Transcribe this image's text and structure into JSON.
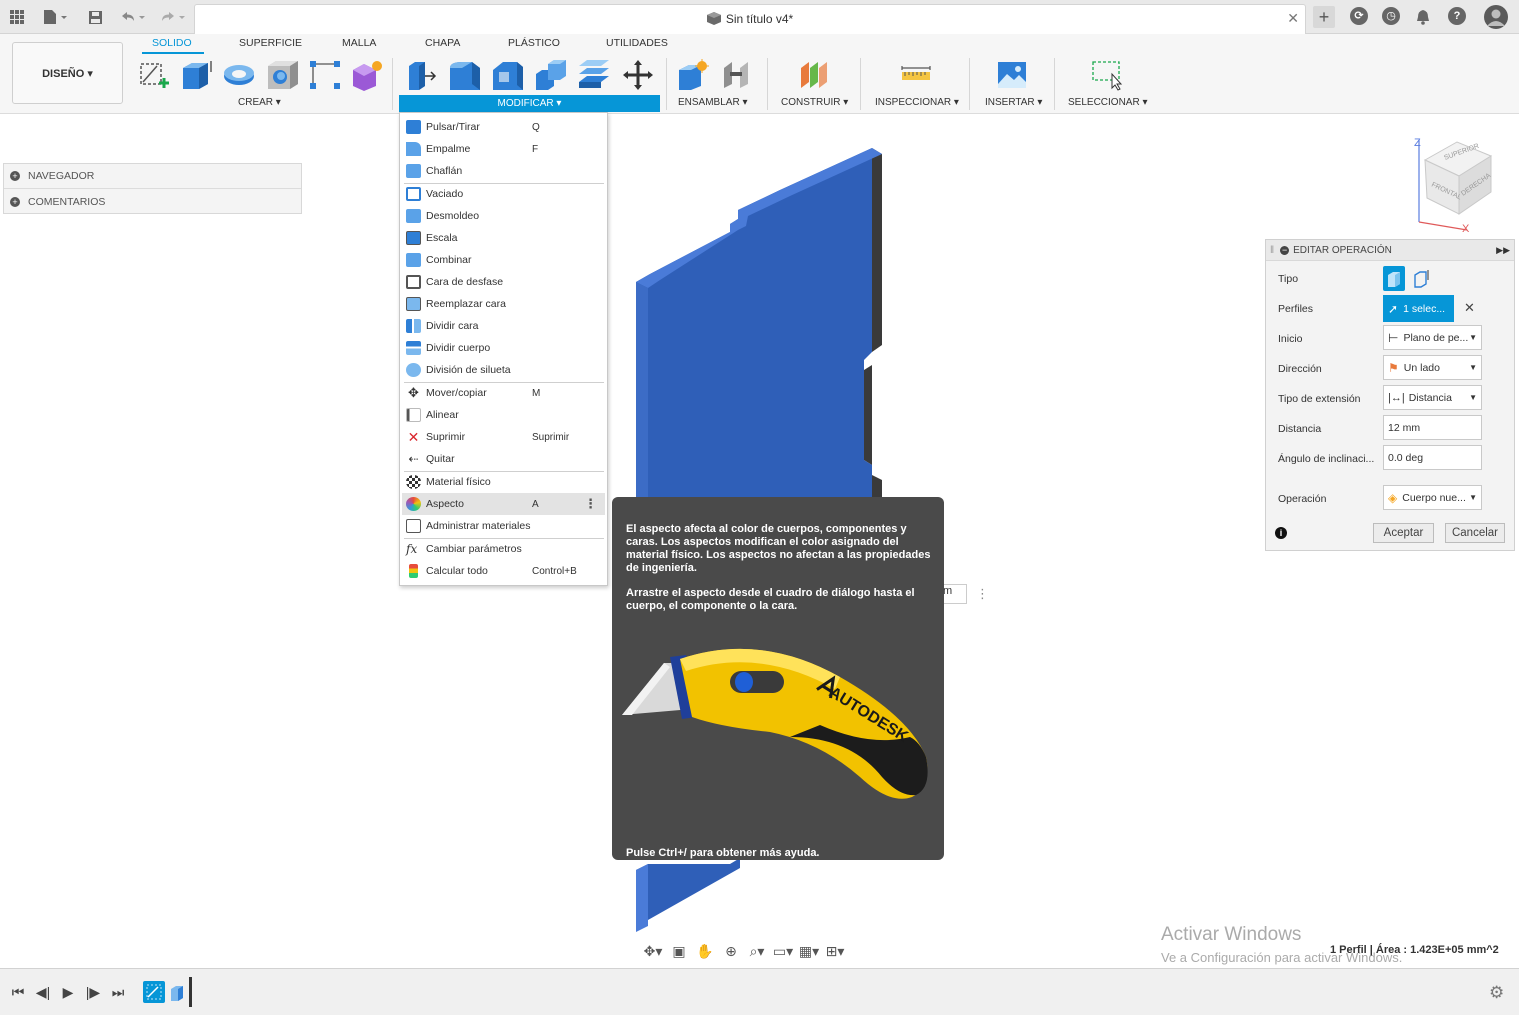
{
  "window": {
    "doc_title": "Sin título v4*"
  },
  "ribbon": {
    "design_button": "DISEÑO ▾",
    "tabs": [
      "SOLIDO",
      "SUPERFICIE",
      "MALLA",
      "CHAPA",
      "PLÁSTICO",
      "UTILIDADES"
    ],
    "active_tab": "SOLIDO",
    "groups": {
      "create": "CREAR ▾",
      "modify": "MODIFICAR ▾",
      "assemble": "ENSAMBLAR ▾",
      "construct": "CONSTRUIR ▾",
      "inspect": "INSPECCIONAR ▾",
      "insert": "INSERTAR ▾",
      "select": "SELECCIONAR ▾"
    },
    "accent_color": "#0696d7"
  },
  "browser": {
    "items": [
      "NAVEGADOR",
      "COMENTARIOS"
    ]
  },
  "modify_menu": {
    "items": [
      {
        "label": "Pulsar/Tirar",
        "shortcut": "Q",
        "icon": "press-pull-icon"
      },
      {
        "label": "Empalme",
        "shortcut": "F",
        "icon": "fillet-icon"
      },
      {
        "label": "Chaflán",
        "shortcut": "",
        "icon": "chamfer-icon"
      },
      {
        "label": "Vaciado",
        "shortcut": "",
        "icon": "shell-icon"
      },
      {
        "label": "Desmoldeo",
        "shortcut": "",
        "icon": "draft-icon"
      },
      {
        "label": "Escala",
        "shortcut": "",
        "icon": "scale-icon"
      },
      {
        "label": "Combinar",
        "shortcut": "",
        "icon": "combine-icon"
      },
      {
        "label": "Cara de desfase",
        "shortcut": "",
        "icon": "offset-face-icon"
      },
      {
        "label": "Reemplazar cara",
        "shortcut": "",
        "icon": "replace-face-icon"
      },
      {
        "label": "Dividir cara",
        "shortcut": "",
        "icon": "split-face-icon"
      },
      {
        "label": "Dividir cuerpo",
        "shortcut": "",
        "icon": "split-body-icon"
      },
      {
        "label": "División de silueta",
        "shortcut": "",
        "icon": "silhouette-split-icon"
      },
      {
        "label": "Mover/copiar",
        "shortcut": "M",
        "icon": "move-icon"
      },
      {
        "label": "Alinear",
        "shortcut": "",
        "icon": "align-icon"
      },
      {
        "label": "Suprimir",
        "shortcut": "Suprimir",
        "icon": "delete-icon"
      },
      {
        "label": "Quitar",
        "shortcut": "",
        "icon": "remove-icon"
      },
      {
        "label": "Material físico",
        "shortcut": "",
        "icon": "physical-material-icon"
      },
      {
        "label": "Aspecto",
        "shortcut": "A",
        "icon": "appearance-icon"
      },
      {
        "label": "Administrar materiales",
        "shortcut": "",
        "icon": "manage-materials-icon"
      },
      {
        "label": "Cambiar parámetros",
        "shortcut": "",
        "icon": "parameters-icon"
      },
      {
        "label": "Calcular todo",
        "shortcut": "Control+B",
        "icon": "compute-all-icon"
      }
    ],
    "highlighted": "Aspecto"
  },
  "tooltip": {
    "para1": "El aspecto afecta al color de cuerpos, componentes y caras. Los aspectos modifican el color asignado del material físico. Los aspectos no afectan a las propiedades de ingeniería.",
    "para2": "Arrastre el aspecto desde el cuadro de diálogo hasta el cuerpo, el componente o la cara.",
    "footer": "Pulse Ctrl+/ para obtener más ayuda.",
    "image_brand": "AUTODESK"
  },
  "partial_field": "m",
  "viewcube": {
    "axis_z": "Z",
    "axis_x": "X",
    "face_top": "SUPERIOR",
    "face_front": "FRONTAL",
    "face_right": "DERECHA"
  },
  "edit_panel": {
    "title": "EDITAR OPERACIÓN",
    "rows": [
      {
        "label": "Tipo",
        "value": ""
      },
      {
        "label": "Perfiles",
        "value": "1 selec..."
      },
      {
        "label": "Inicio",
        "value": "Plano de pe..."
      },
      {
        "label": "Dirección",
        "value": "Un lado"
      },
      {
        "label": "Tipo de extensión",
        "value": "Distancia"
      },
      {
        "label": "Distancia",
        "value": "12 mm"
      },
      {
        "label": "Ángulo de inclinaci...",
        "value": "0.0 deg"
      },
      {
        "label": "Operación",
        "value": "Cuerpo nue..."
      }
    ],
    "ok_label": "Aceptar",
    "cancel_label": "Cancelar"
  },
  "status": {
    "profile_info": "1 Perfil | Área : 1.423E+05 mm^2"
  },
  "windows_watermark": {
    "line1": "Activar Windows",
    "line2": "Ve a Configuración para activar Windows."
  }
}
